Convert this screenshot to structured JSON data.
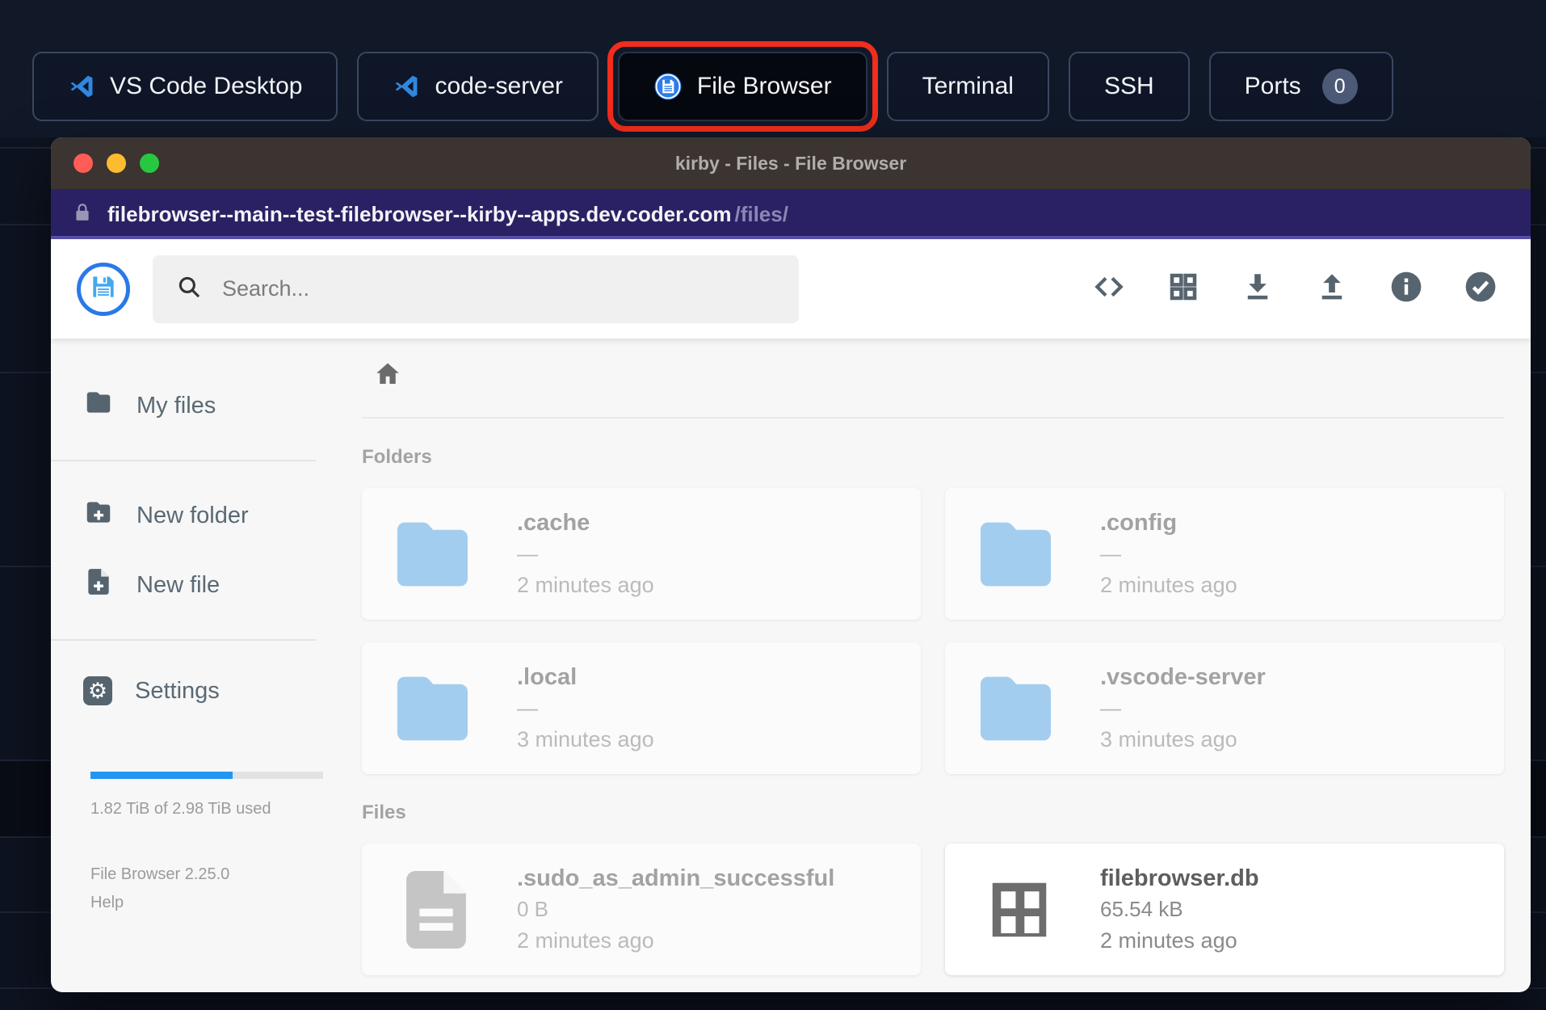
{
  "desktop": {
    "topbar_tabs": [
      {
        "id": "vscode-desktop",
        "label": "VS Code Desktop",
        "icon": "vscode-icon"
      },
      {
        "id": "code-server",
        "label": "code-server",
        "icon": "vscode-icon"
      },
      {
        "id": "file-browser",
        "label": "File Browser",
        "icon": "filebrowser-icon",
        "highlighted": true
      },
      {
        "id": "terminal",
        "label": "Terminal"
      },
      {
        "id": "ssh",
        "label": "SSH"
      },
      {
        "id": "ports",
        "label": "Ports",
        "badge": "0"
      }
    ]
  },
  "window": {
    "title": "kirby - Files - File Browser",
    "url": {
      "domain": "filebrowser--main--test-filebrowser--kirby--apps.dev.coder.com",
      "path": "/files/"
    }
  },
  "toolbar": {
    "search_placeholder": "Search...",
    "actions": [
      {
        "id": "switch-view-code",
        "icon": "code-icon"
      },
      {
        "id": "switch-view-grid",
        "icon": "grid-layout-icon"
      },
      {
        "id": "download",
        "icon": "download-icon"
      },
      {
        "id": "upload",
        "icon": "upload-icon"
      },
      {
        "id": "info",
        "icon": "info-icon"
      },
      {
        "id": "select-multiple",
        "icon": "check-circle-icon"
      }
    ]
  },
  "sidebar": {
    "items": [
      {
        "id": "my-files",
        "label": "My files",
        "icon": "folder-icon"
      },
      {
        "id": "new-folder",
        "label": "New folder",
        "icon": "new-folder-icon",
        "divider_before": true
      },
      {
        "id": "new-file",
        "label": "New file",
        "icon": "new-file-icon"
      },
      {
        "id": "settings",
        "label": "Settings",
        "icon": "settings-icon",
        "divider_before": true
      }
    ],
    "usage": {
      "percent": 61,
      "label": "1.82 TiB of 2.98 TiB used"
    },
    "version": "File Browser 2.25.0",
    "help_label": "Help"
  },
  "files_view": {
    "sections": [
      {
        "heading": "Folders",
        "items": [
          {
            "name": ".cache",
            "size": "—",
            "modified": "2 minutes ago",
            "kind": "folder",
            "hidden": true
          },
          {
            "name": ".config",
            "size": "—",
            "modified": "2 minutes ago",
            "kind": "folder",
            "hidden": true
          },
          {
            "name": ".local",
            "size": "—",
            "modified": "3 minutes ago",
            "kind": "folder",
            "hidden": true
          },
          {
            "name": ".vscode-server",
            "size": "—",
            "modified": "3 minutes ago",
            "kind": "folder",
            "hidden": true
          }
        ]
      },
      {
        "heading": "Files",
        "items": [
          {
            "name": ".sudo_as_admin_successful",
            "size": "0 B",
            "modified": "2 minutes ago",
            "kind": "document",
            "hidden": true
          },
          {
            "name": "filebrowser.db",
            "size": "65.54 kB",
            "modified": "2 minutes ago",
            "kind": "database",
            "hidden": false
          }
        ]
      }
    ]
  },
  "colors": {
    "accent_blue": "#2196f3",
    "highlight_red": "#f12d1c",
    "folder_blue": "#5fabea",
    "icon_slate": "#56646f",
    "url_bar_bg": "#2a2164",
    "title_bar_bg": "#3b3431"
  }
}
